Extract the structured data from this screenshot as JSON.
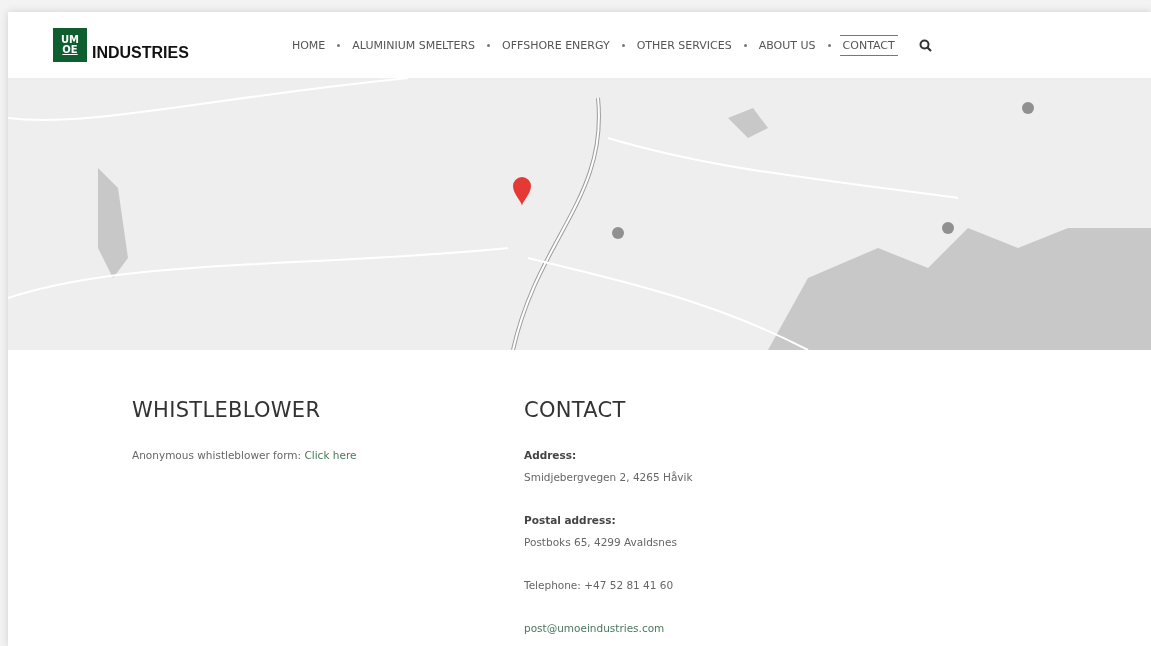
{
  "logo": {
    "mark_top": "UM",
    "mark_bottom": "OE",
    "name": "INDUSTRIES"
  },
  "nav": [
    {
      "label": "HOME",
      "selected": false
    },
    {
      "label": "ALUMINIUM SMELTERS",
      "selected": false
    },
    {
      "label": "OFFSHORE ENERGY",
      "selected": false
    },
    {
      "label": "OTHER SERVICES",
      "selected": false
    },
    {
      "label": "ABOUT US",
      "selected": false
    },
    {
      "label": "CONTACT",
      "selected": true
    }
  ],
  "whistleblower": {
    "heading": "WHISTLEBLOWER",
    "text": "Anonymous whistleblower form: ",
    "link": "Click here"
  },
  "contact": {
    "heading": "CONTACT",
    "blocks": [
      {
        "kind": "labeled",
        "label": "Address:",
        "value": "Smidjebergvegen 2, 4265 Håvik"
      },
      {
        "kind": "labeled",
        "label": "Postal address:",
        "value": "Postboks 65, 4299 Avaldsnes"
      },
      {
        "kind": "plain",
        "value": "Telephone: +47 52 81 41 60"
      },
      {
        "kind": "link",
        "value": "post@umoeindustries.com"
      }
    ]
  }
}
